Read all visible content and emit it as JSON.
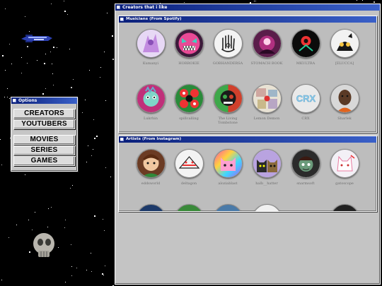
{
  "colors": {
    "titlebar_start": "#0a1f7a",
    "titlebar_end": "#3a60c8",
    "window_bg": "#c6c6c6"
  },
  "main_window": {
    "title": "Creators that i like"
  },
  "musicians": {
    "title": "Musicians (From Spotify)",
    "items": [
      {
        "label": "Kumanyi",
        "icon": "kumanyi-avatar"
      },
      {
        "label": "HORROKIE",
        "icon": "horrokie-avatar"
      },
      {
        "label": "GOBHANDERSA",
        "icon": "hamsa-hand-avatar"
      },
      {
        "label": "STOMACH BOOK",
        "icon": "stomach-book-avatar"
      },
      {
        "label": "MKULTRA",
        "icon": "mkultra-avatar"
      },
      {
        "label": "[ELUCCA]",
        "icon": "elucca-avatar"
      },
      {
        "label": "Lukrhin",
        "icon": "lukrhin-avatar"
      },
      {
        "label": "spillcalling",
        "icon": "spillcalling-avatar"
      },
      {
        "label": "The Living Tombstone",
        "icon": "living-tombstone-avatar"
      },
      {
        "label": "Lemon Demon",
        "icon": "lemon-demon-avatar"
      },
      {
        "label": "CRX",
        "icon": "crx-avatar"
      },
      {
        "label": "Sharlek",
        "icon": "sharlek-avatar"
      }
    ]
  },
  "artists": {
    "title": "Artists (From Instagram)",
    "items": [
      {
        "label": "eddsworld",
        "icon": "eddsworld-avatar"
      },
      {
        "label": "deltagon",
        "icon": "deltagon-avatar"
      },
      {
        "label": "aloziablast",
        "icon": "rainbow-cat-avatar"
      },
      {
        "label": "halb__hatter",
        "icon": "cats-avatar"
      },
      {
        "label": "snarmsoft",
        "icon": "snarmsoft-avatar"
      },
      {
        "label": "gatoscope",
        "icon": "gatoscope-avatar"
      }
    ]
  },
  "options": {
    "title": "Options",
    "buttons": [
      "CREATORS",
      "YOUTUBERS",
      "MOVIES",
      "SERIES",
      "GAMES"
    ]
  }
}
